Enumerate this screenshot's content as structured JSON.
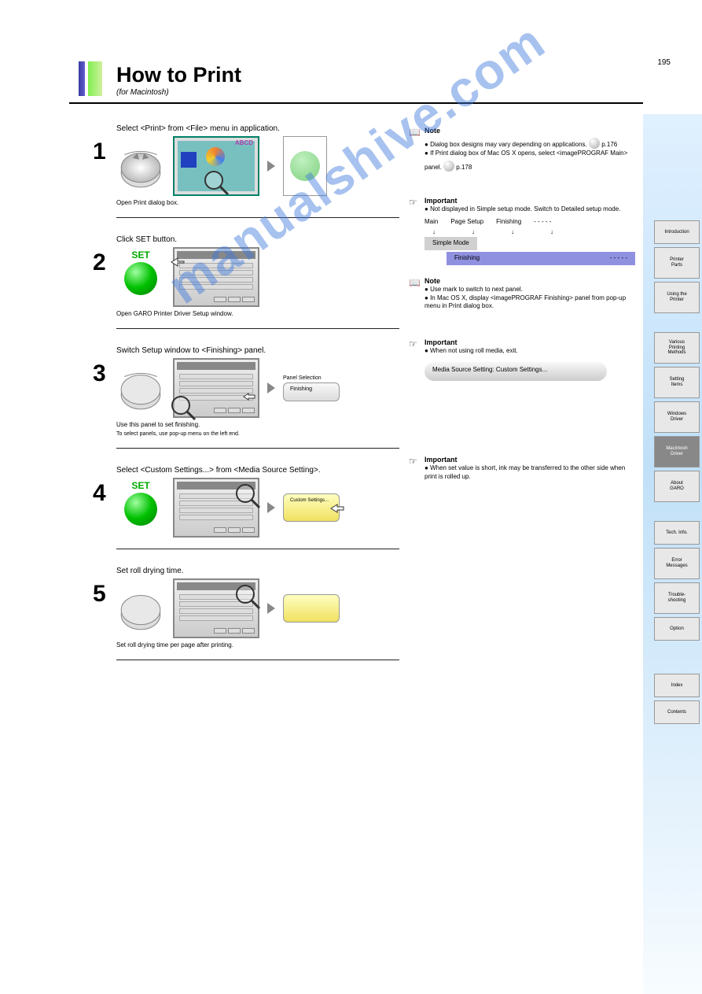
{
  "page_number": "195",
  "header": {
    "title": "How to Print",
    "subtitle": "(for Macintosh)"
  },
  "tabs": [
    {
      "line1": "Introduction"
    },
    {
      "line1": "Printer",
      "line2": "Parts"
    },
    {
      "line1": "Using the",
      "line2": "Printer"
    },
    {
      "line1": "Various",
      "line2": "Printing",
      "line3": "Methods"
    },
    {
      "line1": "Setting",
      "line2": "Items"
    },
    {
      "line1": "Windows",
      "line2": "Driver"
    },
    {
      "line1": "Macintosh",
      "line2": "Driver",
      "active": true
    },
    {
      "line1": "About",
      "line2": "GARO"
    },
    {
      "line1": "Tech. Info."
    },
    {
      "line1": "Error",
      "line2": "Messages"
    },
    {
      "line1": "Trouble-",
      "line2": "shooting"
    },
    {
      "line1": "Option"
    },
    {
      "line1": "Index"
    },
    {
      "line1": "Contents"
    }
  ],
  "steps": {
    "s1": {
      "num": "1",
      "label": "Select <Print> from <File> menu in application.",
      "caption": "Open Print dialog box."
    },
    "s2": {
      "num": "2",
      "label": "Click SET button.",
      "caption": "Open GARO Printer Driver Setup window."
    },
    "s3": {
      "num": "3",
      "label": "Switch Setup window to <Finishing> panel.",
      "caption": "Use this panel to set finishing.",
      "popup_title": "Panel Selection",
      "panel_tab": "Finishing",
      "extra": "To select panels, use     pop-up menu on the left end."
    },
    "s4": {
      "num": "4",
      "label": "Select <Custom Settings...> from <Media Source Setting>.",
      "caption": "",
      "popup_chip": "Custom Settings..."
    },
    "s5": {
      "num": "5",
      "label": "Set roll drying time.",
      "caption": "Set roll drying time per page after printing."
    }
  },
  "info": {
    "note1": {
      "title": "Note",
      "text_a": "Dialog box designs may vary depending on applications.",
      "text_b": "If Print dialog box of Mac OS X opens, select <imagePROGRAF Main> panel.",
      "bubble_ref_a": "p.176",
      "bubble_ref_b": "p.178"
    },
    "important1": {
      "title": "Important",
      "text": "Not displayed in Simple setup mode. Switch to Detailed setup mode.",
      "path": {
        "c1": "Main",
        "c2": "Page Setup",
        "c3": "Finishing",
        "c4": "- - - - -",
        "tab1": "Simple Mode",
        "tab2": "Finishing",
        "tab3": "- - - - -"
      }
    },
    "note2": {
      "title": "Note",
      "text_a": "Use       mark to switch to next panel.",
      "text_b": "In Mac OS X, display <imagePROGRAF Finishing> panel from pop-up menu in Print dialog box."
    },
    "important2": {
      "title": "Important",
      "text": "When not using roll media, exit.",
      "chip": "Media Source Setting:    Custom Settings..."
    },
    "important3": {
      "title": "Important",
      "text": "When set value is short, ink may be transferred to the other side when print is rolled up."
    }
  },
  "watermark": "manualshive.com"
}
